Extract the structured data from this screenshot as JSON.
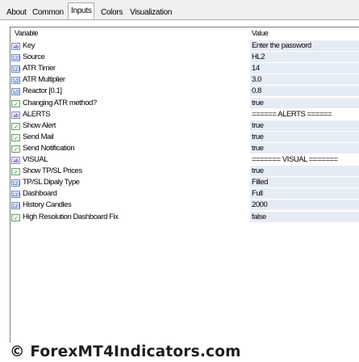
{
  "tabs": [
    "About",
    "Common",
    "Inputs",
    "Colors",
    "Visualization"
  ],
  "active_tab": "Inputs",
  "columns": {
    "variable": "Variable",
    "value": "Value"
  },
  "rows": [
    {
      "icon": "string-type-icon",
      "name": "Key",
      "value": "Enter the password"
    },
    {
      "icon": "integer-type-icon",
      "name": "Source",
      "value": "HL2"
    },
    {
      "icon": "integer-type-icon",
      "name": "ATR Timer",
      "value": "14"
    },
    {
      "icon": "double-type-icon",
      "name": "ATR Multiplier",
      "value": "3.0"
    },
    {
      "icon": "double-type-icon",
      "name": "Reactor [0.1]",
      "value": "0.8"
    },
    {
      "icon": "boolean-type-icon",
      "name": "Changing ATR method?",
      "value": "true"
    },
    {
      "icon": "string-type-icon",
      "name": "ALERTS",
      "value": "====== ALERTS ======"
    },
    {
      "icon": "boolean-type-icon",
      "name": "Show Alert",
      "value": "true"
    },
    {
      "icon": "boolean-type-icon",
      "name": "Send Mail",
      "value": "true"
    },
    {
      "icon": "boolean-type-icon",
      "name": "Send Notification",
      "value": "true"
    },
    {
      "icon": "string-type-icon",
      "name": "VISUAL",
      "value": "======= VISUAL ======="
    },
    {
      "icon": "boolean-type-icon",
      "name": "Show TP/SL Prices",
      "value": "true"
    },
    {
      "icon": "integer-type-icon",
      "name": "TP/SL Dipaly Type",
      "value": "Filled"
    },
    {
      "icon": "integer-type-icon",
      "name": "Dashboard",
      "value": "Full"
    },
    {
      "icon": "integer-type-icon",
      "name": "History Candles",
      "value": "2000"
    },
    {
      "icon": "boolean-type-icon",
      "name": "High Resolution Dashboard Fix",
      "value": "false"
    }
  ],
  "watermark": "© ForexMT4Indicators.com",
  "colors": {
    "row_shade": "#e6ecf5",
    "panel_bg": "#ffffff",
    "window_bg": "#f0f0f0"
  }
}
